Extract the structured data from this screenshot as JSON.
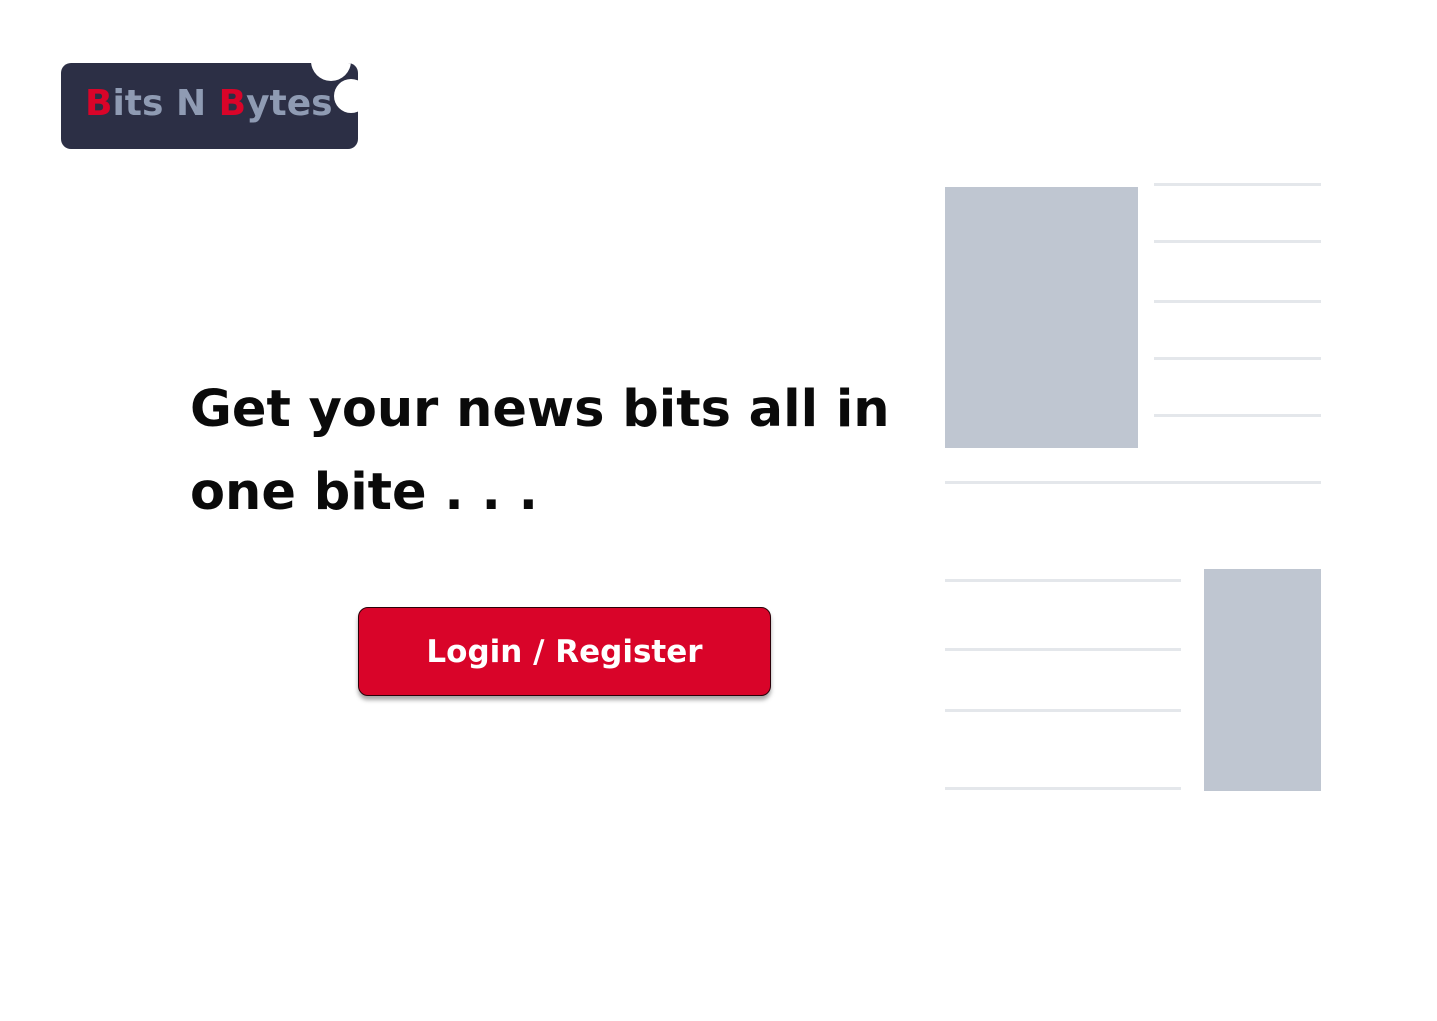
{
  "brand": {
    "part1_accent": "B",
    "part1_rest": "its N ",
    "part2_accent": "B",
    "part2_rest": "ytes",
    "accent_color": "#d90429",
    "base_color": "#8f9bb3",
    "background_color": "#2c2f45"
  },
  "hero": {
    "headline": "Get your news bits all in one bite . . ."
  },
  "cta": {
    "label": "Login / Register",
    "color": "#d90429"
  },
  "illustration": {
    "placeholder_color": "#bfc6d1",
    "line_color": "#e4e7eb"
  }
}
